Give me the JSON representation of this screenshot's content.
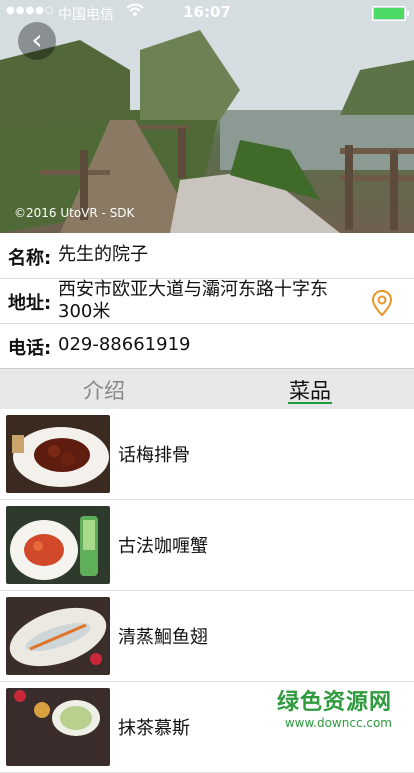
{
  "status_bar": {
    "carrier": "中国电信",
    "time": "16:07"
  },
  "hero": {
    "copyright": "©2016 UtoVR - SDK"
  },
  "info": {
    "name_label": "名称:",
    "name_value": "先生的院子",
    "address_label": "地址:",
    "address_value": "西安市欧亚大道与灞河东路十字东300米",
    "phone_label": "电话:",
    "phone_value": "029-88661919"
  },
  "tabs": {
    "intro": "介绍",
    "dishes": "菜品",
    "active": "dishes"
  },
  "dishes": [
    {
      "name": "话梅排骨"
    },
    {
      "name": "古法咖喱蟹"
    },
    {
      "name": "清蒸鮰鱼翅"
    },
    {
      "name": "抹茶慕斯"
    }
  ],
  "watermark": {
    "line1": "绿色资源网",
    "line2": "www.downcc.com"
  },
  "colors": {
    "accent_green": "#1d9e3c",
    "pin_orange": "#e8962a",
    "battery_green": "#4cd964"
  }
}
